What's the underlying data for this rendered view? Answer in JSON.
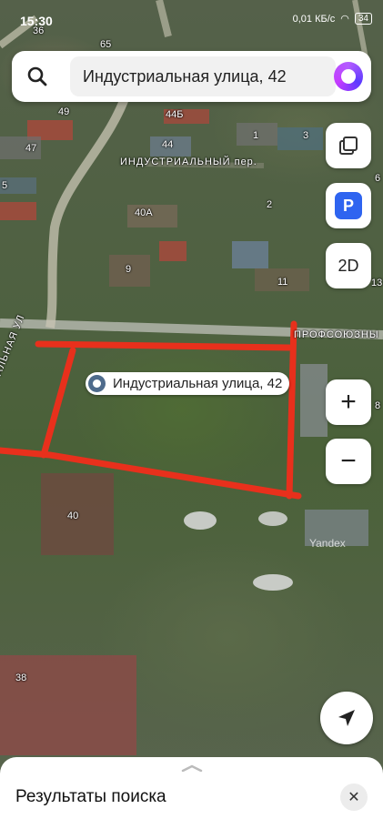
{
  "status_bar": {
    "time": "15:30",
    "network_speed": "0,01 КБ/с",
    "battery": "34"
  },
  "search": {
    "query": "Индустриальная улица, 42"
  },
  "map_controls": {
    "layers_icon": "layers-icon",
    "parking_label": "P",
    "mode_label": "2D",
    "zoom_in_label": "+",
    "zoom_out_label": "−"
  },
  "map_labels": {
    "houses": [
      "36",
      "65",
      "49",
      "44Б",
      "47",
      "44",
      "1",
      "3",
      "6",
      "5",
      "40А",
      "2",
      "9",
      "11",
      "13",
      "8",
      "40",
      "38"
    ],
    "street_industrial_lane": "ИНДУСТРИАЛЬНЫЙ пер.",
    "street_profsoyuznaya": "ПРОФСОЮЗНЫ",
    "street_vertical": "АЛЬНАЯ УЛ",
    "watermark": "Yandex"
  },
  "pin": {
    "label": "Индустриальная улица, 42"
  },
  "sheet": {
    "title": "Результаты поиска",
    "close": "✕"
  },
  "colors": {
    "accent_blue": "#2e64f0",
    "boundary_red": "#e8301c"
  }
}
